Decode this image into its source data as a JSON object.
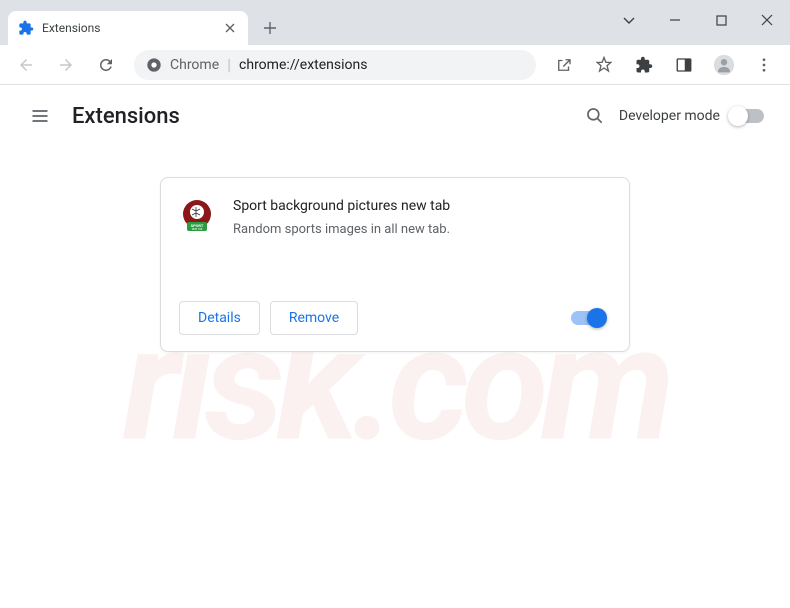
{
  "tab": {
    "title": "Extensions"
  },
  "address": {
    "prefix": "Chrome",
    "url": "chrome://extensions"
  },
  "header": {
    "title": "Extensions",
    "devmode_label": "Developer mode"
  },
  "extension": {
    "name": "Sport background pictures new tab",
    "description": "Random sports images in all new tab.",
    "details_label": "Details",
    "remove_label": "Remove",
    "enabled": true
  },
  "watermark": "pc risk.com"
}
